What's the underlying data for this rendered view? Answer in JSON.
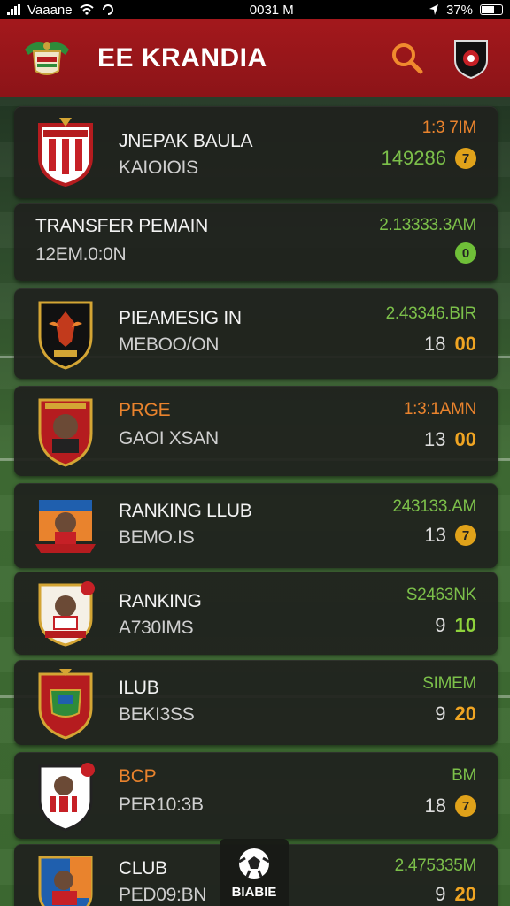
{
  "status_bar": {
    "carrier": "Vaaane",
    "time": "0031 M",
    "battery": "37%"
  },
  "header": {
    "title": "EE KRANDIA"
  },
  "items": [
    {
      "title": "JNEPAK BAULA",
      "subtitle": "KAIOIOIS",
      "right_top": "1:3 7IM",
      "right_bottom": "149286",
      "indicator": "7"
    },
    {
      "title": "TRANSFER PEMAIN",
      "subtitle": "12EM.0:0N",
      "right_top": "2.13333.3AM",
      "right_bottom": "",
      "indicator": "0"
    },
    {
      "title": "PIEAMESIG IN",
      "subtitle": "MEBOO/ON",
      "right_top": "2.43346.BIR",
      "right_bottom": "18",
      "indicator": "00"
    },
    {
      "title": "PRGE",
      "subtitle": "GAOI XSAN",
      "right_top": "1:3:1AMN",
      "right_bottom": "13",
      "indicator": "00"
    },
    {
      "title": "RANKING LLUB",
      "subtitle": "BEMO.IS",
      "right_top": "243133.AM",
      "right_bottom": "13",
      "indicator": "7"
    },
    {
      "title": "RANKING",
      "subtitle": "A730IMS",
      "right_top": "S2463NK",
      "right_bottom": "9",
      "indicator": "10"
    },
    {
      "title": "ILUB",
      "subtitle": "BEKI3SS",
      "right_top": "SIMEM",
      "right_bottom": "9",
      "indicator": "20"
    },
    {
      "title": "BCP",
      "subtitle": "PER10:3B",
      "right_top": "BM",
      "right_bottom": "18",
      "indicator": "7"
    },
    {
      "title": "CLUB",
      "subtitle": "PED09:BN",
      "right_top": "2.475335M",
      "right_bottom": "9",
      "indicator": "20"
    }
  ],
  "bottom_tab": {
    "label": "BIABIE"
  },
  "colors": {
    "header_red": "#9c1a1e",
    "accent_orange": "#f0a523",
    "accent_green": "#7cc04a"
  }
}
